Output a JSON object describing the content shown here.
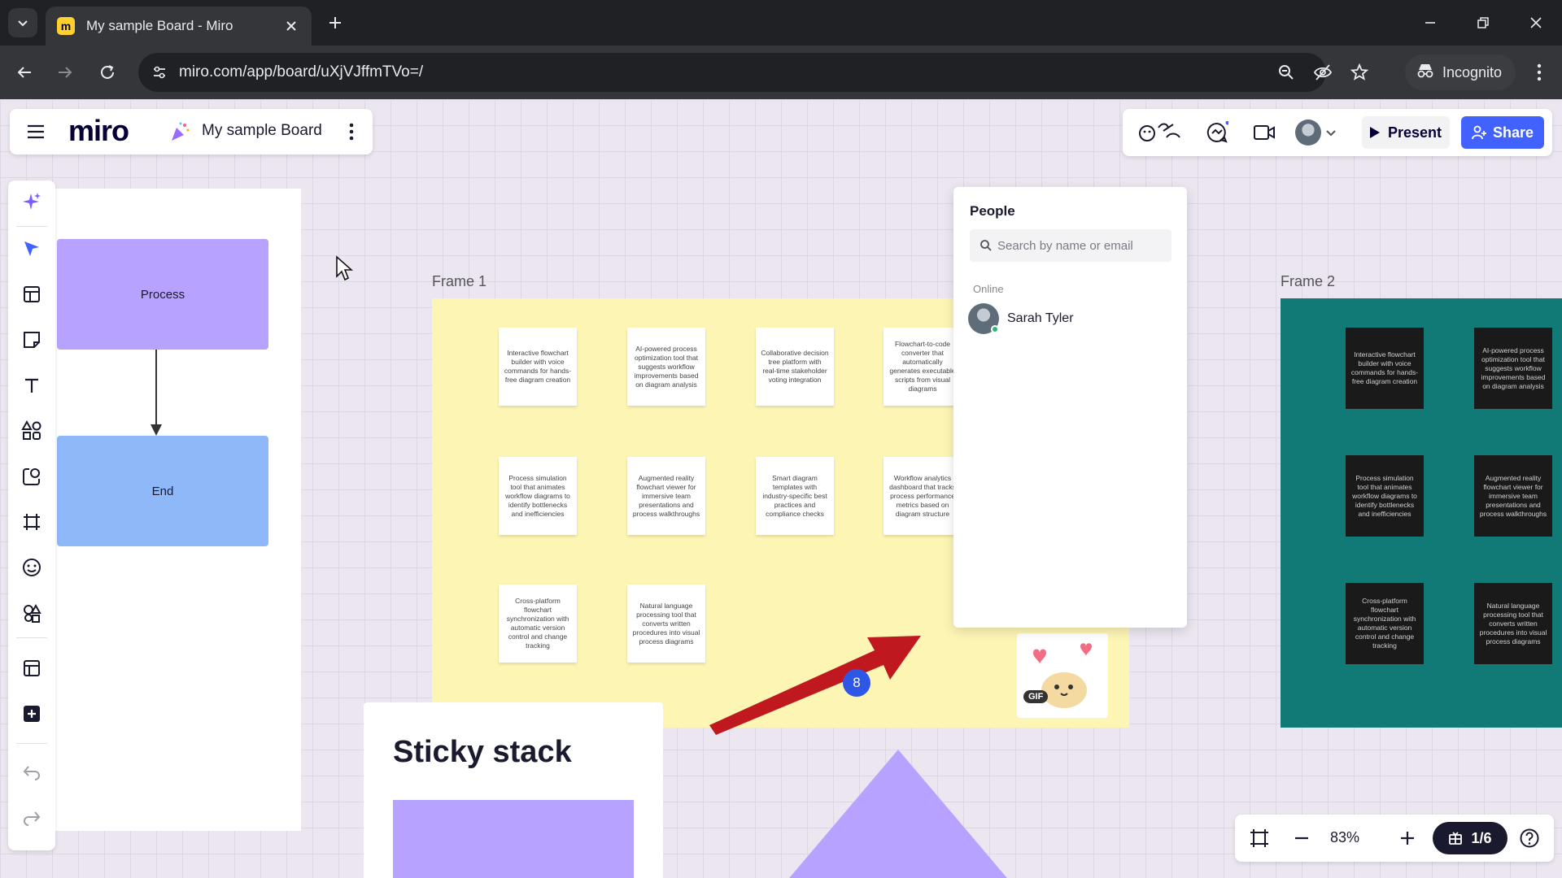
{
  "browser": {
    "tab_title": "My sample Board - Miro",
    "url": "miro.com/app/board/uXjVJffmTVo=/",
    "incognito_label": "Incognito"
  },
  "board": {
    "logo": "miro",
    "name": "My sample Board",
    "present_label": "Present",
    "share_label": "Share",
    "accent_color": "#4262ff"
  },
  "flowchart": {
    "process_label": "Process",
    "end_label": "End"
  },
  "frames": {
    "frame1_label": "Frame 1",
    "frame2_label": "Frame 2",
    "frame1_stickies": [
      "Interactive flowchart builder with voice commands for hands-free diagram creation",
      "AI-powered process optimization tool that suggests workflow improvements based on diagram analysis",
      "Collaborative decision tree platform with real-time stakeholder voting integration",
      "Flowchart-to-code converter that automatically generates executable scripts from visual diagrams",
      "Process simulation tool that animates workflow diagrams to identify bottlenecks and inefficiencies",
      "Augmented reality flowchart viewer for immersive team presentations and process walkthroughs",
      "Smart diagram templates with industry-specific best practices and compliance checks",
      "Workflow analytics dashboard that tracks process performance metrics based on diagram structure",
      "Cross-platform flowchart synchronization with automatic version control and change tracking",
      "Natural language processing tool that converts written procedures into visual process diagrams"
    ],
    "frame2_stickies": [
      "Interactive flowchart builder with voice commands for hands-free diagram creation",
      "AI-powered process optimization tool that suggests workflow improvements based on diagram analysis",
      "Process simulation tool that animates workflow diagrams to identify bottlenecks and inefficiencies",
      "Augmented reality flowchart viewer for immersive team presentations and process walkthroughs",
      "Cross-platform flowchart synchronization with automatic version control and change tracking",
      "Natural language processing tool that converts written procedures into visual process diagrams"
    ]
  },
  "badge_count": "8",
  "gif_label": "GIF",
  "people_panel": {
    "title": "People",
    "search_placeholder": "Search by name or email",
    "section_online": "Online",
    "users": [
      {
        "name": "Sarah Tyler",
        "status": "online"
      }
    ]
  },
  "sticky_stack": {
    "title": "Sticky stack"
  },
  "zoom": {
    "level": "83%",
    "pages": "1/6"
  },
  "icons": {
    "tabbar": [
      "tab-list-icon",
      "miro-favicon",
      "close-icon",
      "plus-icon",
      "minimize-icon",
      "restore-icon",
      "window-close-icon"
    ],
    "toolbar": [
      "back-icon",
      "forward-icon",
      "reload-icon",
      "site-settings-icon",
      "zoom-icon",
      "eye-off-icon",
      "star-icon",
      "incognito-icon",
      "more-vert-icon"
    ],
    "tools": [
      "sparkle-icon",
      "select-icon",
      "templates-icon",
      "sticky-note-icon",
      "text-icon",
      "shapes-icon",
      "connection-icon",
      "frame-icon",
      "sticker-icon",
      "integrations-icon",
      "layout-icon",
      "plus-square-icon",
      "undo-icon",
      "redo-icon"
    ],
    "collab": [
      "reactions-icon",
      "chat-icon",
      "video-icon",
      "chevron-down-icon"
    ],
    "zoom_bar": [
      "fit-icon",
      "minus-icon",
      "plus-icon",
      "pages-icon",
      "help-icon"
    ]
  }
}
